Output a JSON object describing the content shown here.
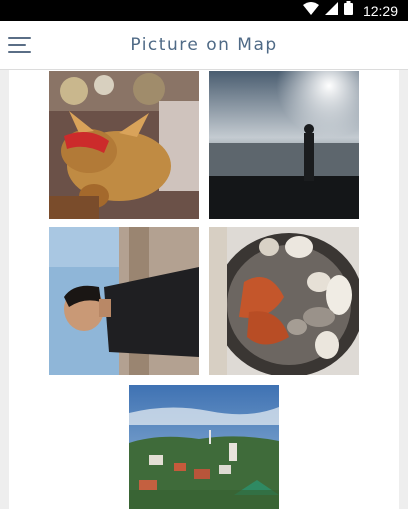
{
  "status_bar": {
    "time": "12:29",
    "icons": [
      "wifi-icon",
      "signal-icon",
      "battery-icon"
    ]
  },
  "app_bar": {
    "title": "Picture on Map",
    "menu_icon": "hamburger-menu-icon"
  },
  "photos": [
    {
      "id": "photo-1",
      "description": "golden bull figurine with red ribbon"
    },
    {
      "id": "photo-2",
      "description": "person silhouette by the sea at sunset"
    },
    {
      "id": "photo-3",
      "description": "young man posing against blue sky"
    },
    {
      "id": "photo-4",
      "description": "grilled fish and vegetables in a pan"
    },
    {
      "id": "photo-5",
      "description": "town view with trees and a tower"
    }
  ],
  "colors": {
    "status_bar": "#000000",
    "accent": "#4f6a86",
    "background": "#eeeeee"
  }
}
